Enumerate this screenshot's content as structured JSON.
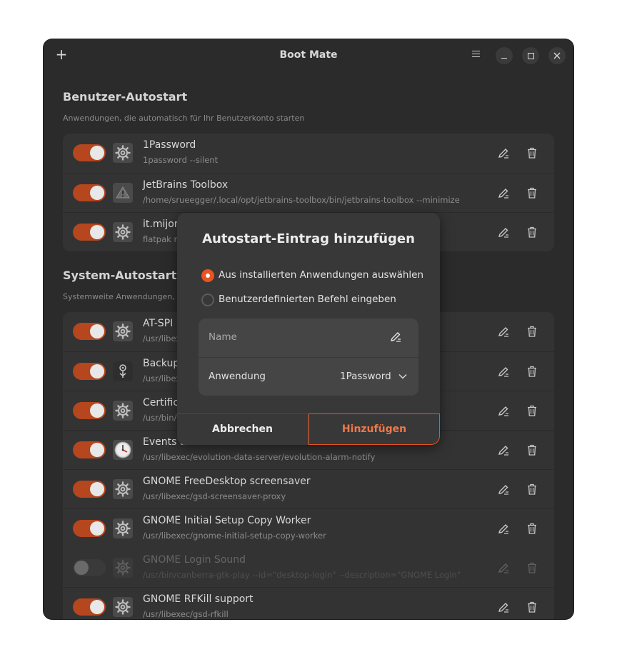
{
  "window": {
    "title": "Boot Mate"
  },
  "user_section": {
    "title": "Benutzer-Autostart",
    "subtitle": "Anwendungen, die automatisch für Ihr Benutzerkonto starten",
    "items": [
      {
        "title": "1Password",
        "command": "1password --silent",
        "enabled": true,
        "icon": "gear-icon"
      },
      {
        "title": "JetBrains Toolbox",
        "command": "/home/srueegger/.local/opt/jetbrains-toolbox/bin/jetbrains-toolbox --minimize",
        "enabled": true,
        "icon": "warning-icon"
      },
      {
        "title": "it.mijor",
        "command": "flatpak ru",
        "enabled": true,
        "icon": "gear-icon"
      }
    ]
  },
  "system_section": {
    "title": "System-Autostart",
    "subtitle": "Systemweite Anwendungen,",
    "items": [
      {
        "title": "AT-SPI I",
        "command": "/usr/libex",
        "enabled": true,
        "icon": "gear-icon"
      },
      {
        "title": "Backup",
        "command": "/usr/libex",
        "enabled": true,
        "icon": "backup-icon"
      },
      {
        "title": "Certific",
        "command": "/usr/bin/",
        "enabled": true,
        "icon": "gear-icon"
      },
      {
        "title": "Events and Tasks Reminders",
        "command": "/usr/libexec/evolution-data-server/evolution-alarm-notify",
        "enabled": true,
        "icon": "clock-icon"
      },
      {
        "title": "GNOME FreeDesktop screensaver",
        "command": "/usr/libexec/gsd-screensaver-proxy",
        "enabled": true,
        "icon": "gear-icon"
      },
      {
        "title": "GNOME Initial Setup Copy Worker",
        "command": "/usr/libexec/gnome-initial-setup-copy-worker",
        "enabled": true,
        "icon": "gear-icon"
      },
      {
        "title": "GNOME Login Sound",
        "command": "/usr/bin/canberra-gtk-play --id=\"desktop-login\" --description=\"GNOME Login\"",
        "enabled": false,
        "icon": "gear-icon"
      },
      {
        "title": "GNOME RFKill support",
        "command": "/usr/libexec/gsd-rfkill",
        "enabled": true,
        "icon": "gear-icon"
      }
    ]
  },
  "dialog": {
    "title": "Autostart-Eintrag hinzufügen",
    "option_installed": "Aus installierten Anwendungen auswählen",
    "option_custom": "Benutzerdefinierten Befehl eingeben",
    "name_placeholder": "Name",
    "app_label": "Anwendung",
    "app_value": "1Password",
    "cancel_label": "Abbrechen",
    "add_label": "Hinzufügen"
  },
  "colors": {
    "accent": "#e95420",
    "toggle_on": "#b5461e"
  }
}
